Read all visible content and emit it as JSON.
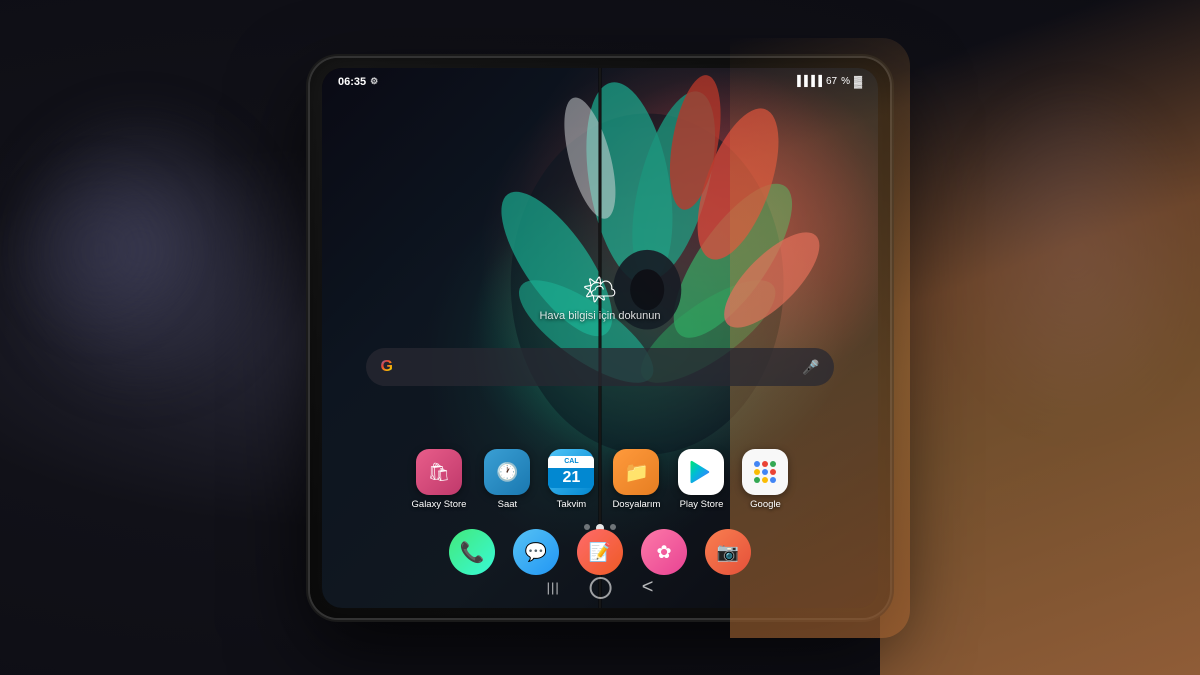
{
  "scene": {
    "bg_color": "#111118"
  },
  "phone": {
    "status_bar": {
      "time": "06:35",
      "settings_icon": "⚙",
      "signal_bars": "▌▌▌▌",
      "battery_percent": "67",
      "battery_icon": "🔋"
    },
    "weather": {
      "icon": "🌤",
      "text": "Hava bilgisi için dokunun"
    },
    "search_bar": {
      "google_label": "G",
      "mic_label": "🎤"
    },
    "app_row": [
      {
        "id": "galaxy-store",
        "label": "Galaxy Store",
        "icon": "🛍",
        "color_class": "icon-galaxy-store"
      },
      {
        "id": "saat",
        "label": "Saat",
        "icon": "🕐",
        "color_class": "icon-saat"
      },
      {
        "id": "takvim",
        "label": "Takvim",
        "icon": "21",
        "color_class": "icon-takvim"
      },
      {
        "id": "dosyalarim",
        "label": "Dosyalarım",
        "icon": "📁",
        "color_class": "icon-dosyalarim"
      },
      {
        "id": "play-store",
        "label": "Play Store",
        "icon": "▶",
        "color_class": "icon-play-store"
      },
      {
        "id": "google",
        "label": "Google",
        "icon": "G",
        "color_class": "icon-google"
      }
    ],
    "bottom_row": [
      {
        "id": "phone",
        "label": "",
        "type": "phone"
      },
      {
        "id": "messages",
        "label": "",
        "type": "messages"
      },
      {
        "id": "notes",
        "label": "",
        "type": "notes"
      },
      {
        "id": "bixby",
        "label": "",
        "type": "bixby"
      },
      {
        "id": "camera",
        "label": "",
        "type": "camera"
      }
    ],
    "nav": {
      "back": "‹",
      "home": "○",
      "recents": "|||"
    },
    "page_dots": [
      false,
      true,
      false
    ]
  }
}
